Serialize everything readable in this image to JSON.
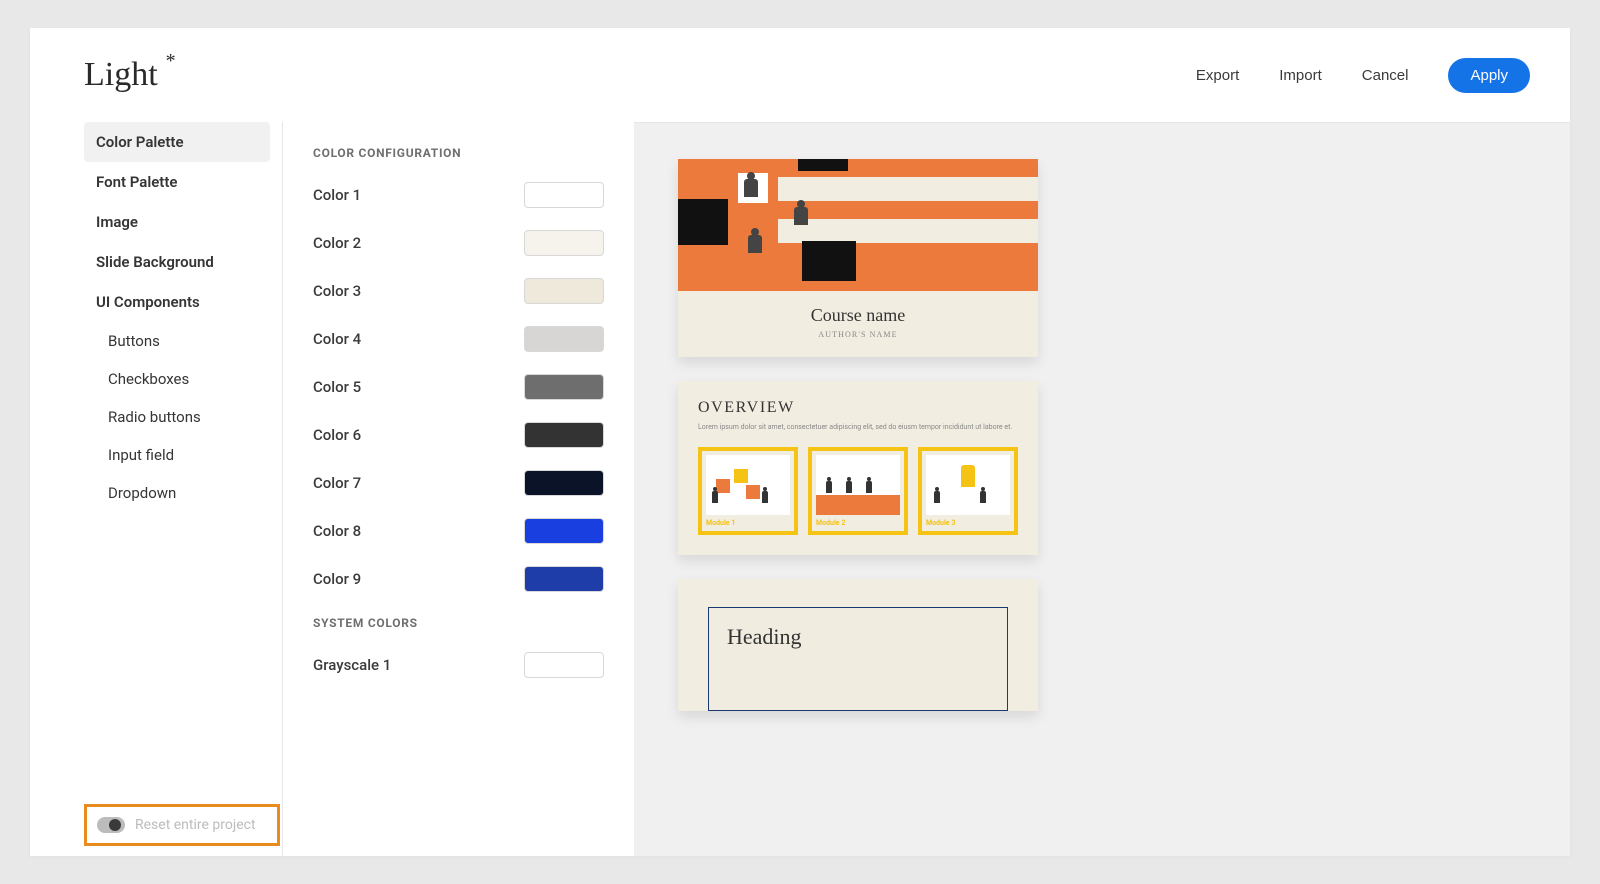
{
  "header": {
    "title": "Light",
    "dirty_marker": "*",
    "actions": {
      "export": "Export",
      "import": "Import",
      "cancel": "Cancel",
      "apply": "Apply"
    }
  },
  "sidebar": {
    "items": [
      {
        "label": "Color Palette",
        "active": true
      },
      {
        "label": "Font Palette"
      },
      {
        "label": "Image"
      },
      {
        "label": "Slide Background"
      },
      {
        "label": "UI Components"
      }
    ],
    "ui_components": [
      {
        "label": "Buttons"
      },
      {
        "label": "Checkboxes"
      },
      {
        "label": "Radio buttons"
      },
      {
        "label": "Input field"
      },
      {
        "label": "Dropdown"
      }
    ],
    "reset": {
      "label": "Reset entire project",
      "on": false
    }
  },
  "config": {
    "section1_title": "COLOR CONFIGURATION",
    "colors": [
      {
        "label": "Color 1",
        "value": "#ffffff"
      },
      {
        "label": "Color 2",
        "value": "#f6f3ec"
      },
      {
        "label": "Color 3",
        "value": "#efe9db"
      },
      {
        "label": "Color 4",
        "value": "#d7d6d4"
      },
      {
        "label": "Color 5",
        "value": "#6e6e6e"
      },
      {
        "label": "Color 6",
        "value": "#333333"
      },
      {
        "label": "Color 7",
        "value": "#0a1328"
      },
      {
        "label": "Color 8",
        "value": "#1a3fe0"
      },
      {
        "label": "Color 9",
        "value": "#1f3da8"
      }
    ],
    "section2_title": "SYSTEM COLORS",
    "system_colors": [
      {
        "label": "Grayscale 1",
        "value": "#ffffff"
      }
    ]
  },
  "preview": {
    "card1": {
      "course_name": "Course name",
      "author": "AUTHOR'S NAME"
    },
    "card2": {
      "title": "OVERVIEW",
      "lorem": "Lorem ipsum dolor sit amet, consectetuer adipiscing elit, sed do eiusm tempor incididunt ut labore et.",
      "modules": [
        {
          "caption": "Module 1"
        },
        {
          "caption": "Module 2"
        },
        {
          "caption": "Module 3"
        }
      ]
    },
    "card3": {
      "heading": "Heading"
    }
  }
}
